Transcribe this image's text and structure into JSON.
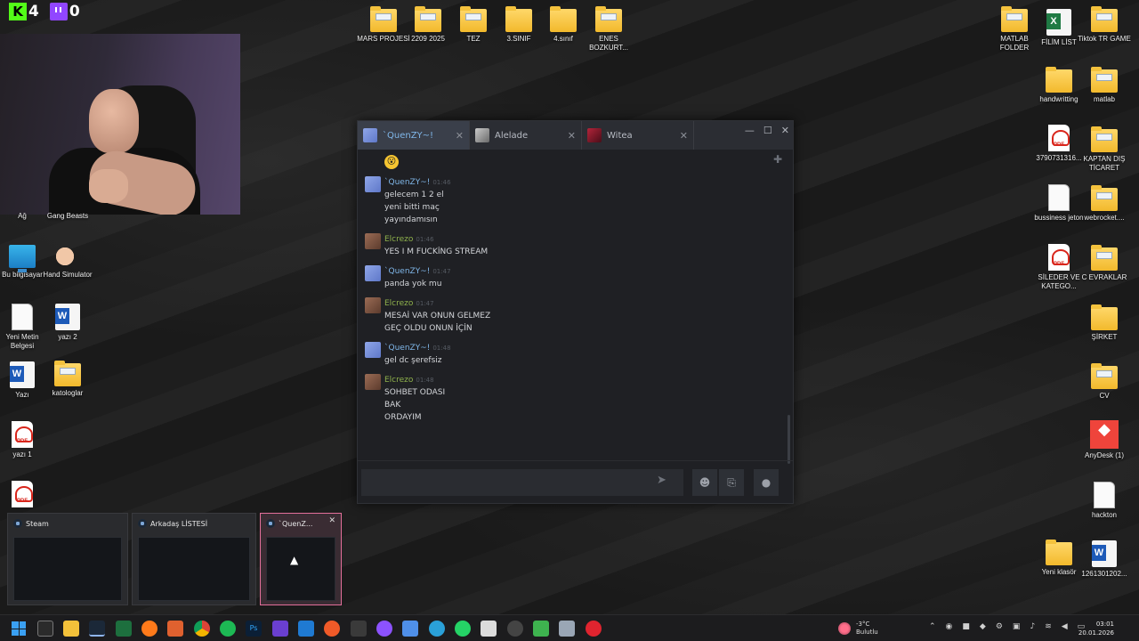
{
  "desktop_icons_top": [
    {
      "label": "MARS PROJESİ",
      "type": "folder"
    },
    {
      "label": "2209 2025",
      "type": "folder"
    },
    {
      "label": "TEZ",
      "type": "folder"
    },
    {
      "label": "3.SINIF",
      "type": "folder"
    },
    {
      "label": "4.sınıf",
      "type": "folder"
    },
    {
      "label": "ENES BOZKURT...",
      "type": "folder"
    }
  ],
  "desktop_icons_left": [
    {
      "label": "Ağ"
    },
    {
      "label": "Gang Beasts"
    },
    {
      "label": "Bu bilgisayar"
    },
    {
      "label": "Hand Simulator"
    },
    {
      "label": "Yeni Metin Belgesi"
    },
    {
      "label": "yazı 2"
    },
    {
      "label": "Yazı"
    },
    {
      "label": "katologlar"
    },
    {
      "label": "yazı 1"
    }
  ],
  "desktop_icons_right": [
    {
      "label": "MATLAB FOLDER"
    },
    {
      "label": "FİLİM LİST"
    },
    {
      "label": "Tiktok TR GAME"
    },
    {
      "label": "handwritting"
    },
    {
      "label": "matlab"
    },
    {
      "label": "3790731316..."
    },
    {
      "label": "KAPTAN DIŞ TİCARET"
    },
    {
      "label": "bussiness jeton"
    },
    {
      "label": "webrocket...."
    },
    {
      "label": "SİLEDER VE KATEGO..."
    },
    {
      "label": "C EVRAKLAR"
    },
    {
      "label": "ŞİRKET"
    },
    {
      "label": "CV"
    },
    {
      "label": "AnyDesk (1)"
    },
    {
      "label": "hackton"
    },
    {
      "label": "Yeni klasör"
    },
    {
      "label": "1261301202..."
    }
  ],
  "stream_overlay": {
    "kick_count": "4",
    "twitch_count": "0"
  },
  "chat_window": {
    "tabs": [
      {
        "label": "`QuenZY~!",
        "active": true
      },
      {
        "label": "Alelade",
        "active": false
      },
      {
        "label": "Witea",
        "active": false
      }
    ],
    "messages": [
      {
        "author": "`QuenZY~!",
        "time": "01:46",
        "lines": [
          "gelecem 1 2 el",
          "yeni bitti maç",
          "yayındamısın"
        ],
        "who": "q"
      },
      {
        "author": "Elcrezo",
        "time": "01:46",
        "lines": [
          "YES I M FUCKİNG STREAM"
        ],
        "who": "e"
      },
      {
        "author": "`QuenZY~!",
        "time": "01:47",
        "lines": [
          "panda yok mu"
        ],
        "who": "q"
      },
      {
        "author": "Elcrezo",
        "time": "01:47",
        "lines": [
          "MESAİ VAR ONUN GELMEZ",
          "GEÇ OLDU ONUN İÇİN"
        ],
        "who": "e"
      },
      {
        "author": "`QuenZY~!",
        "time": "01:48",
        "lines": [
          "gel dc şerefsiz"
        ],
        "who": "q"
      },
      {
        "author": "Elcrezo",
        "time": "01:48",
        "lines": [
          "SOHBET ODASI",
          "BAK",
          "ORDAYIM"
        ],
        "who": "e"
      }
    ],
    "input_placeholder": ""
  },
  "taskbar_previews": [
    {
      "title": "Steam"
    },
    {
      "title": "Arkadaş LİSTESİ"
    },
    {
      "title": "`QuenZ..."
    }
  ],
  "taskbar": {
    "weather_temp": "-3°C",
    "weather_desc": "Bulutlu",
    "time": "03:01",
    "date": "20.01.2026"
  }
}
